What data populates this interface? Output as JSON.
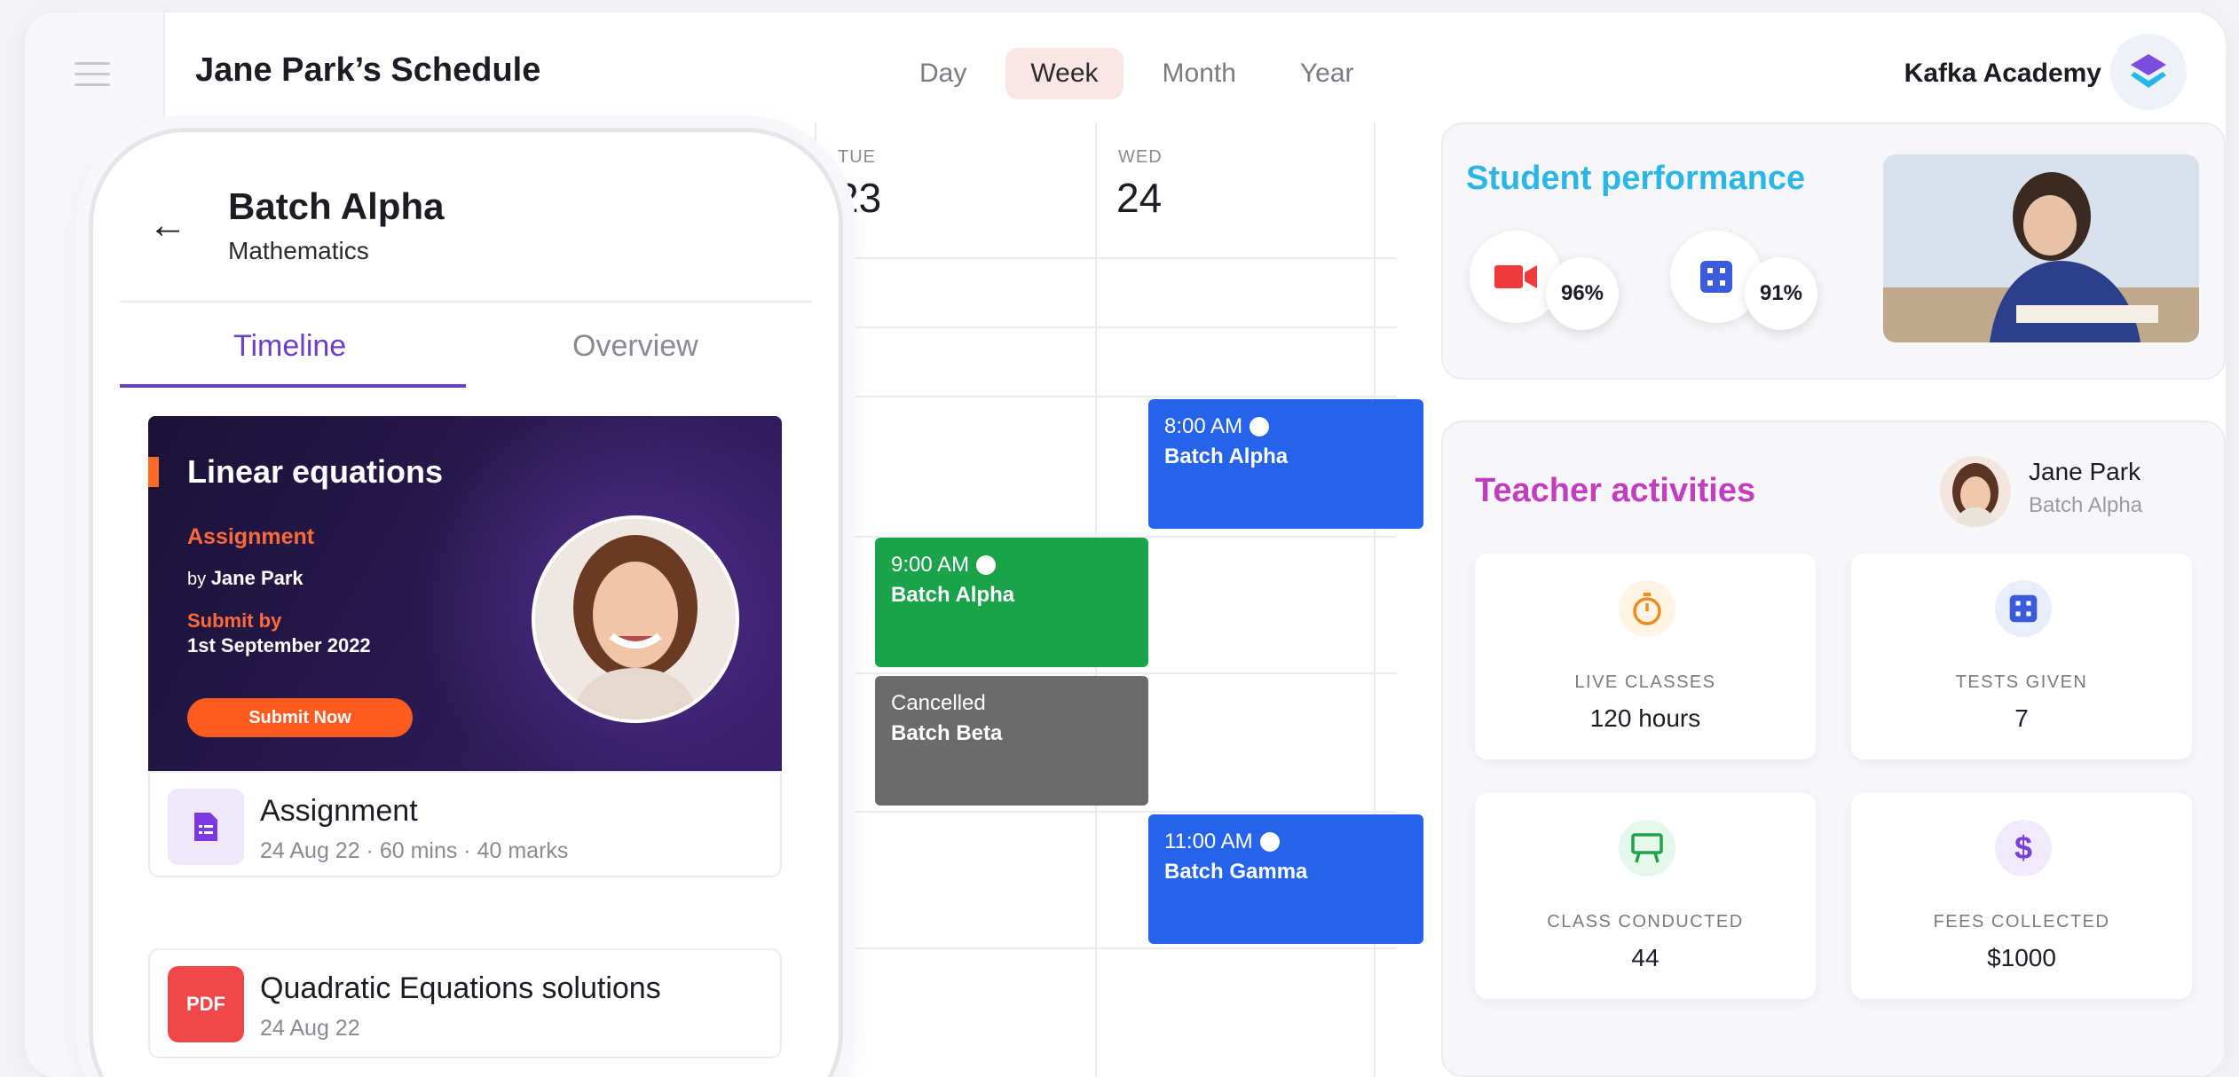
{
  "header": {
    "title": "Jane Park’s Schedule",
    "view_tabs": [
      "Day",
      "Week",
      "Month",
      "Year"
    ],
    "active_view": "Week",
    "org_name": "Kafka Academy"
  },
  "calendar": {
    "days": [
      {
        "name": "TUE",
        "num": "23"
      },
      {
        "name": "WED",
        "num": "24"
      }
    ],
    "events": [
      {
        "time": "8:00 AM",
        "batch": "Batch Alpha",
        "color": "#2563eb"
      },
      {
        "time": "9:00 AM",
        "batch": "Batch Alpha",
        "color": "#1aa34a"
      },
      {
        "time": "Cancelled",
        "batch": "Batch Beta",
        "color": "#6b6b6b"
      },
      {
        "time": "11:00 AM",
        "batch": "Batch Gamma",
        "color": "#2563eb"
      }
    ]
  },
  "phone": {
    "title": "Batch Alpha",
    "subtitle": "Mathematics",
    "tabs": [
      "Timeline",
      "Overview"
    ],
    "active_tab": "Timeline",
    "banner": {
      "title": "Linear equations",
      "type": "Assignment",
      "by_prefix": "by",
      "by_name": "Jane Park",
      "submit_label": "Submit by",
      "submit_date": "1st September 2022",
      "button": "Submit Now"
    },
    "items": [
      {
        "title": "Assignment",
        "meta": "24 Aug 22 · 60 mins · 40 marks",
        "icon": "assignment-icon"
      },
      {
        "title": "Quadratic Equations solutions",
        "meta": "24 Aug 22",
        "icon": "pdf-icon",
        "icon_text": "PDF"
      }
    ]
  },
  "student_performance": {
    "title": "Student performance",
    "metrics": [
      {
        "icon": "video-icon",
        "value": "96%"
      },
      {
        "icon": "test-icon",
        "value": "91%"
      }
    ]
  },
  "teacher_activities": {
    "title": "Teacher activities",
    "teacher_name": "Jane Park",
    "teacher_batch": "Batch Alpha",
    "stats": [
      {
        "label": "LIVE CLASSES",
        "value": "120 hours",
        "icon": "stopwatch-icon"
      },
      {
        "label": "TESTS GIVEN",
        "value": "7",
        "icon": "test-icon"
      },
      {
        "label": "CLASS CONDUCTED",
        "value": "44",
        "icon": "presentation-icon"
      },
      {
        "label": "FEES COLLECTED",
        "value": "$1000",
        "icon": "dollar-icon"
      }
    ]
  },
  "colors": {
    "accent_purple": "#6c3fc9",
    "performance_title": "#2bb6e6",
    "activities_title": "#c13ec1",
    "orange": "#ff5a1f"
  }
}
